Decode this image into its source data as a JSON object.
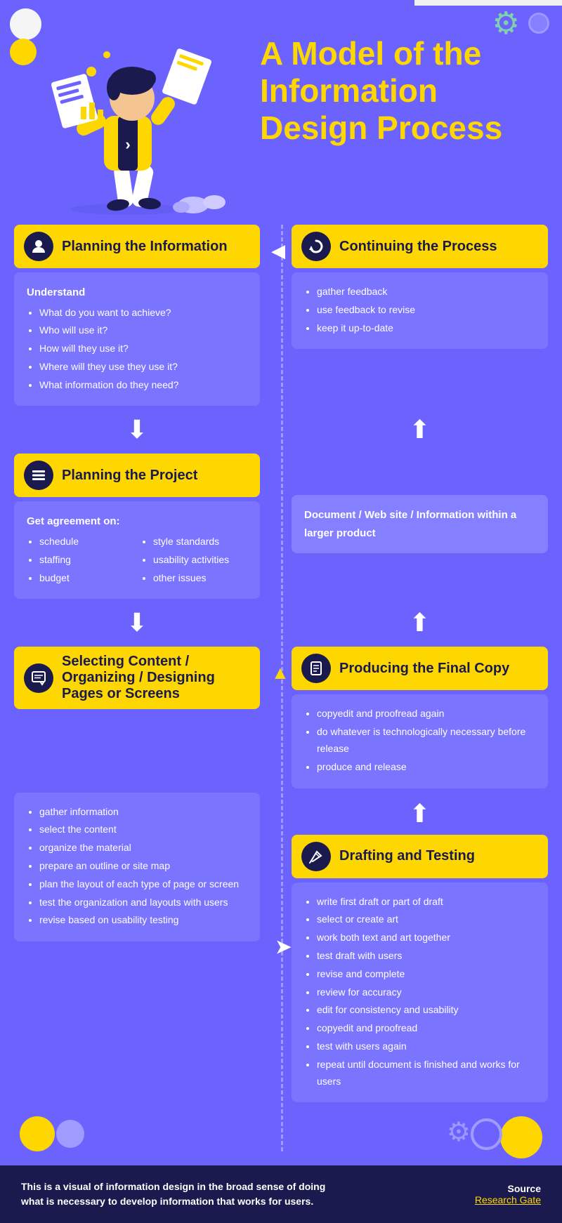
{
  "title": "A Model of the Information Design Process",
  "header": {
    "title_line1": "A Model of the",
    "title_line2": "Information",
    "title_line3": "Design Process"
  },
  "sections": {
    "planning_info": {
      "title": "Planning the Information",
      "icon": "👤",
      "bold_label": "Understand",
      "items": [
        "What do you want to achieve?",
        "Who will use it?",
        "How will they use it?",
        "Where will they use they use it?",
        "What information do they need?"
      ]
    },
    "continuing": {
      "title": "Continuing the Process",
      "icon": "🔄",
      "items": [
        "gather feedback",
        "use feedback to revise",
        "keep it up-to-date"
      ]
    },
    "planning_project": {
      "title": "Planning the Project",
      "icon": "☰",
      "bold_label": "Get agreement on:",
      "col1": [
        "schedule",
        "staffing",
        "budget"
      ],
      "col2": [
        "style standards",
        "usability activities",
        "other issues"
      ]
    },
    "document_type": {
      "text": "Document  /  Web site  /  Information within a larger product"
    },
    "producing": {
      "title": "Producing the Final Copy",
      "icon": "📄",
      "items": [
        "copyedit and proofread again",
        "do whatever is technologically necessary before release",
        "produce and release"
      ]
    },
    "selecting": {
      "title": "Selecting Content / Organizing / Designing Pages or Screens",
      "icon": "📝",
      "items": [
        "gather information",
        "select the content",
        "organize the material",
        "prepare an outline or site map",
        "plan the layout of each type of page or screen",
        "test the organization and layouts with users",
        "revise based on usability testing"
      ]
    },
    "drafting": {
      "title": "Drafting and Testing",
      "icon": "✏️",
      "items": [
        "write first draft or part of draft",
        "select or create art",
        "work both text and art together",
        "test draft with users",
        "revise and complete",
        "review for accuracy",
        "edit for consistency and usability",
        "copyedit and proofread",
        "test with users again",
        "repeat until document is finished and works for users"
      ]
    }
  },
  "footer": {
    "text": "This is a visual of information design in the broad sense of doing what is necessary to develop information that works for users.",
    "source_label": "Source",
    "source_link": "Research Gate"
  },
  "decorative": {
    "arrow_down": "⬇",
    "arrow_up": "⬆",
    "arrow_left": "◀",
    "arrow_right": "➤"
  }
}
